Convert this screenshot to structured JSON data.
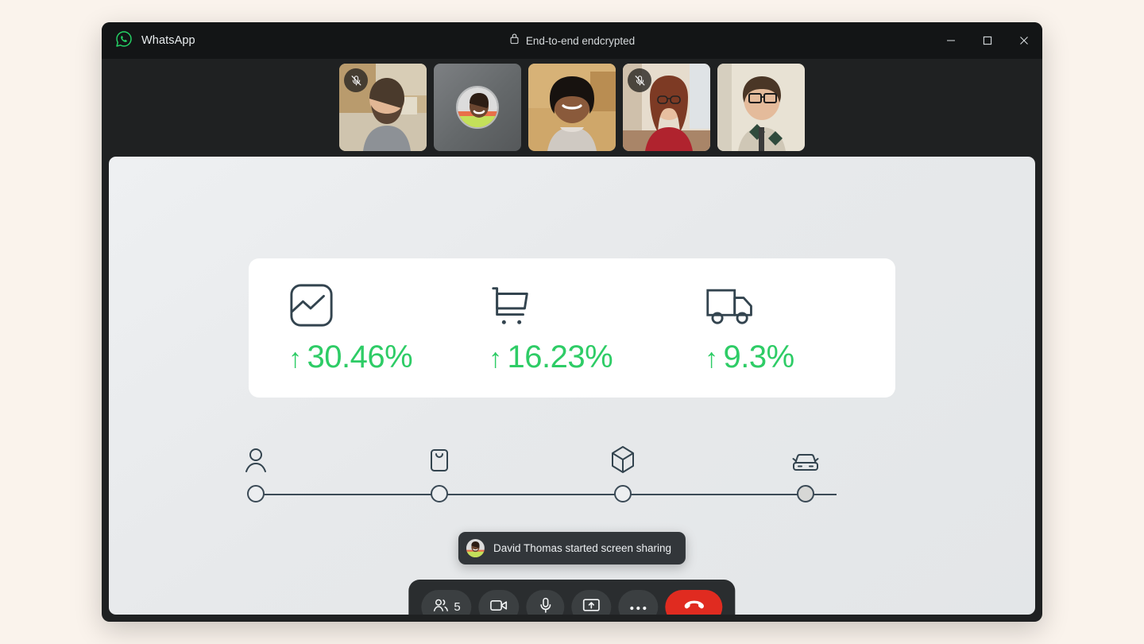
{
  "window": {
    "brand_label": "WhatsApp",
    "brand_icon": "whatsapp-logo-icon",
    "security_label": "End-to-end endcrypted",
    "security_icon": "lock-icon",
    "controls": {
      "minimize": "minimize-icon",
      "maximize": "maximize-icon",
      "close": "close-icon"
    }
  },
  "filmstrip": {
    "participants": [
      {
        "id": "p1",
        "muted": true,
        "camera_on": true,
        "bg": "#b79f79"
      },
      {
        "id": "p2",
        "muted": false,
        "camera_on": false,
        "bg": "#6e7174"
      },
      {
        "id": "p3",
        "muted": false,
        "camera_on": true,
        "bg": "#c9a570"
      },
      {
        "id": "p4",
        "muted": true,
        "camera_on": true,
        "bg": "#d9cbbc"
      },
      {
        "id": "p5",
        "muted": false,
        "camera_on": true,
        "bg": "#ded6c6"
      }
    ],
    "mute_icon": "mic-muted-icon"
  },
  "stage": {
    "stats": [
      {
        "icon": "analytics-chart-icon",
        "arrow": "↑",
        "value": "30.46%"
      },
      {
        "icon": "shopping-cart-icon",
        "arrow": "↑",
        "value": "16.23%"
      },
      {
        "icon": "delivery-truck-icon",
        "arrow": "↑",
        "value": "9.3%"
      }
    ],
    "accent_green": "#2ecc66",
    "tracker": {
      "steps": [
        {
          "icon": "person-icon",
          "filled": false
        },
        {
          "icon": "shopping-bag-icon",
          "filled": false
        },
        {
          "icon": "package-box-icon",
          "filled": false
        },
        {
          "icon": "car-icon",
          "filled": true
        }
      ]
    }
  },
  "toast": {
    "avatar": "participant-avatar",
    "text": "David Thomas started screen sharing"
  },
  "controls": {
    "participants_icon": "people-icon",
    "participants_count": "5",
    "camera_icon": "video-camera-icon",
    "mic_icon": "microphone-icon",
    "share_icon": "share-screen-icon",
    "more_icon": "more-options-icon",
    "end_call_icon": "end-call-icon",
    "end_call_color": "#e02b20"
  }
}
